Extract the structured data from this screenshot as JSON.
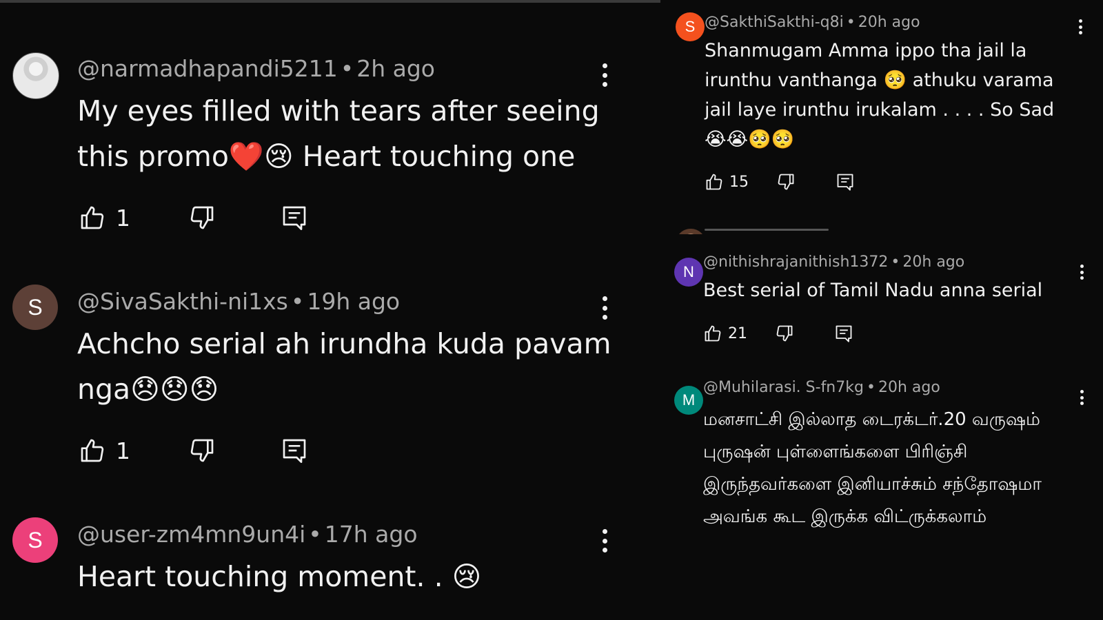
{
  "left_comments": [
    {
      "avatar": {
        "type": "photo",
        "letter": "",
        "color": "#d9d9d9"
      },
      "username": "@narmadhapandi5211",
      "time": "2h ago",
      "text": "My eyes filled with tears after seeing this promo❤️😢 Heart touching one",
      "likes": "1"
    },
    {
      "avatar": {
        "type": "letter",
        "letter": "S",
        "color": "#5d4037"
      },
      "username": "@SivaSakthi-ni1xs",
      "time": "19h ago",
      "text": "Achcho serial ah irundha kuda pavam nga😞😞😞",
      "likes": "1"
    },
    {
      "avatar": {
        "type": "letter",
        "letter": "S",
        "color": "#ec407a"
      },
      "username": "@user-zm4mn9un4i",
      "time": "17h ago",
      "text": "Heart touching moment. . 😢",
      "likes": ""
    }
  ],
  "right_comments": [
    {
      "avatar": {
        "type": "letter",
        "letter": "S",
        "color": "#f4511e"
      },
      "username": "@SakthiSakthi-q8i",
      "time": "20h ago",
      "text": "Shanmugam Amma ippo tha jail la irunthu vanthanga 🥺 athuku varama jail laye irunthu irukalam . . . . So Sad 😭😭🥺🥺",
      "likes": "15"
    },
    {
      "avatar": {
        "type": "letter",
        "letter": "N",
        "color": "#5e35b1"
      },
      "username": "@nithishrajanithish1372",
      "time": "20h ago",
      "text": "Best serial of Tamil Nadu anna serial",
      "likes": "21"
    },
    {
      "avatar": {
        "type": "letter",
        "letter": "M",
        "color": "#00897b"
      },
      "username": "@Muhilarasi. S-fn7kg",
      "time": "20h ago",
      "text": "மனசாட்சி இல்லாத டைரக்டர்.20 வருஷம் புருஷன் புள்ளைங்களை பிரிஞ்சி இருந்தவர்களை இனியாச்சும் சந்தோஷமா அவங்க கூட இருக்க விட்ருக்கலாம்",
      "likes": ""
    }
  ],
  "icons": {
    "like": "thumb-up-icon",
    "dislike": "thumb-down-icon",
    "reply": "reply-icon",
    "more": "more-vert-icon"
  },
  "colors": {
    "background": "#0a0a0a",
    "meta_text": "#aaaaaa",
    "body_text": "#f1f1f1"
  }
}
